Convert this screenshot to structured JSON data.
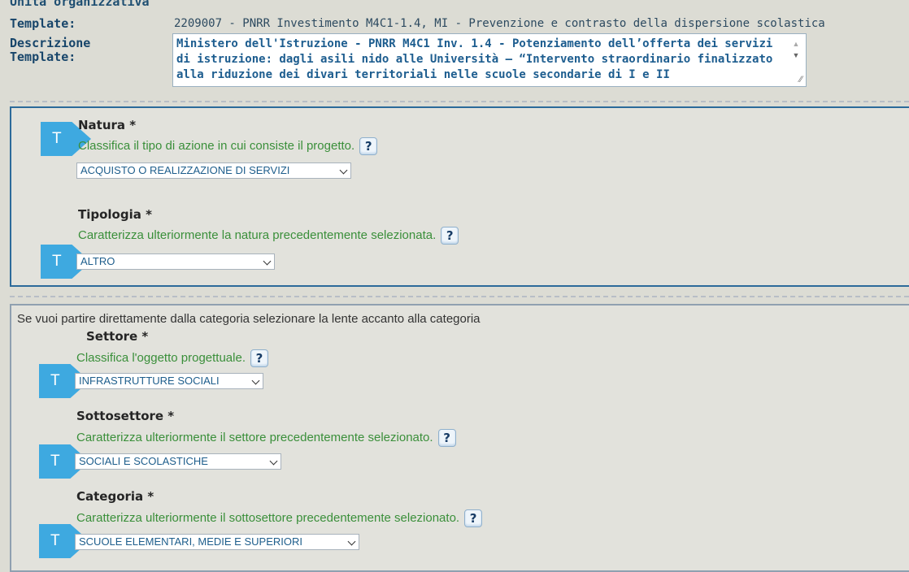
{
  "header": {
    "cut_label": "Unità organizzativa",
    "template_label": "Template:",
    "template_value": "2209007 - PNRR Investimento M4C1-1.4, MI - Prevenzione e contrasto della dispersione scolastica",
    "description_label_line1": "Descrizione",
    "description_label_line2": "Template:",
    "description_text": "Ministero dell'Istruzione - PNRR M4C1 Inv. 1.4 - Potenziamento dell’offerta dei servizi di istruzione: dagli asili nido alle Università – “Intervento straordinario finalizzato alla riduzione dei divari territoriali nelle scuole secondarie di I e II"
  },
  "section1": {
    "natura": {
      "title": "Natura *",
      "description": "Classifica il tipo di azione in cui consiste il progetto.",
      "selected": "ACQUISTO O REALIZZAZIONE DI SERVIZI"
    },
    "tipologia": {
      "title": "Tipologia *",
      "description": "Caratterizza ulteriormente la natura precedentemente selezionata.",
      "selected": "ALTRO"
    }
  },
  "section2": {
    "intro": "Se vuoi partire direttamente dalla categoria selezionare la lente accanto alla categoria",
    "settore": {
      "title": "Settore *",
      "description": "Classifica l'oggetto progettuale.",
      "selected": "INFRASTRUTTURE SOCIALI"
    },
    "sottosettore": {
      "title": "Sottosettore *",
      "description": "Caratterizza ulteriormente il settore precedentemente selezionato.",
      "selected": "SOCIALI E SCOLASTICHE"
    },
    "categoria": {
      "title": "Categoria *",
      "description": "Caratterizza ulteriormente il sottosettore precedentemente selezionato.",
      "selected": "SCUOLE ELEMENTARI, MEDIE E SUPERIORI"
    }
  },
  "labels": {
    "t_marker": "T",
    "help_glyph": "?"
  },
  "icons": {
    "help": "help-question-icon",
    "marker": "t-arrow-marker-icon",
    "dropdown": "chevron-down-icon"
  },
  "colors": {
    "accent_blue": "#3ea9e0",
    "section_border": "#2c6a9a",
    "description_green": "#3a8f3a",
    "value_blue": "#1e5e8c"
  }
}
